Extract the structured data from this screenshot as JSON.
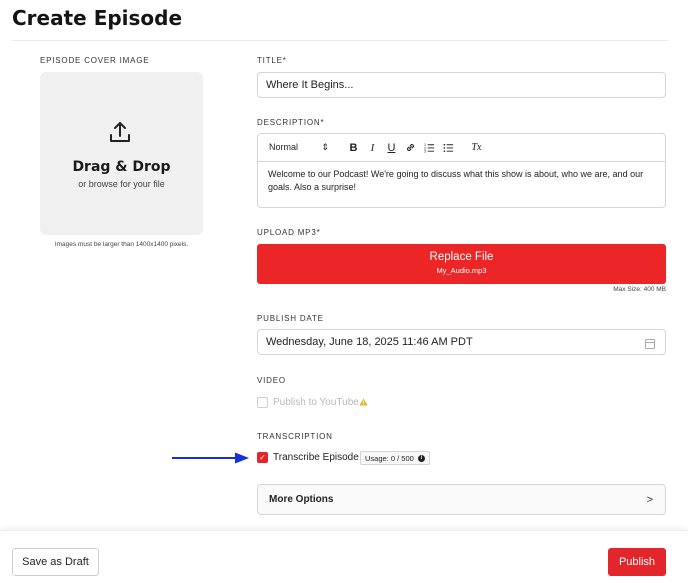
{
  "page": {
    "title": "Create Episode"
  },
  "cover": {
    "label": "EPISODE COVER IMAGE",
    "drop_title": "Drag & Drop",
    "drop_subtitle": "or browse for your file",
    "note": "Images must be larger than 1400x1400 pixels.",
    "icon": "upload-icon"
  },
  "title_field": {
    "label": "TITLE*",
    "value": "Where It Begins..."
  },
  "description": {
    "label": "DESCRIPTION*",
    "format_select": "Normal",
    "toolbar_icons": [
      "bold-icon",
      "italic-icon",
      "underline-icon",
      "link-icon",
      "ordered-list-icon",
      "bullet-list-icon",
      "clear-format-icon"
    ],
    "bold_glyph": "B",
    "italic_glyph": "I",
    "underline_glyph": "U",
    "clear_glyph": "Tx",
    "text": "Welcome to our Podcast! We're going to discuss what this show is about, who we are, and our goals. Also a surprise!"
  },
  "upload": {
    "label": "UPLOAD MP3*",
    "button_label": "Replace File",
    "file_name": "My_Audio.mp3",
    "max_size": "Max Size: 400 MB"
  },
  "publish_date": {
    "label": "PUBLISH DATE",
    "value": "Wednesday, June 18, 2025 11:46 AM PDT",
    "icon": "calendar-icon"
  },
  "video": {
    "label": "VIDEO",
    "option_label": "Publish to YouTube",
    "checked": false,
    "disabled": true,
    "icon": "warning-icon"
  },
  "transcription": {
    "label": "TRANSCRIPTION",
    "option_label": "Transcribe Episode",
    "checked": true,
    "usage": "Usage: 0 / 500",
    "info_glyph": "i"
  },
  "more_options": {
    "label": "More Options",
    "chevron": ">"
  },
  "footer": {
    "draft_label": "Save as Draft",
    "publish_label": "Publish"
  },
  "colors": {
    "accent": "#e3262b",
    "annotation_arrow": "#1631d6"
  }
}
